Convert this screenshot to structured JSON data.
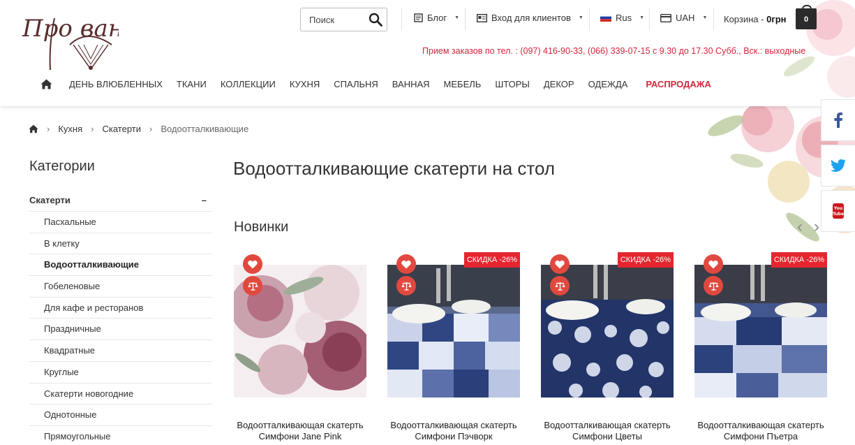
{
  "header": {
    "logo_text": "Про ванс",
    "search": {
      "placeholder": "Поиск"
    },
    "blog_label": "Блог",
    "login_label": "Вход для клиентов",
    "language_label": "Rus",
    "currency_label": "UAH",
    "cart_label": "Корзина -",
    "cart_amount": "0грн",
    "cart_count": "0",
    "hours_phones": "Прием заказов по тел. : (097) 416-90-33, (066) 339-07-15",
    "hours_time": "с 9.30 до 17.30 Субб., Вск.: выходные"
  },
  "nav": {
    "items": [
      "ДЕНЬ ВЛЮБЛЕННЫХ",
      "ТКАНИ",
      "КОЛЛЕКЦИИ",
      "КУХНЯ",
      "СПАЛЬНЯ",
      "ВАННАЯ",
      "МЕБЕЛЬ",
      "ШТОРЫ",
      "ДЕКОР",
      "ОДЕЖДА"
    ],
    "sale_label": "РАСПРОДАЖА"
  },
  "breadcrumb": {
    "items": [
      "Кухня",
      "Скатерти"
    ],
    "current": "Водоотталкивающие"
  },
  "sidebar": {
    "title": "Категории",
    "main_category": "Скатерти",
    "collapse_symbol": "–",
    "subcategories": [
      "Пасхальные",
      "В клетку",
      "Водоотталкивающие",
      "Гобеленовые",
      "Для кафе и ресторанов",
      "Праздничные",
      "Квадратные",
      "Круглые",
      "Скатерти новогодние",
      "Однотонные",
      "Прямоугольные"
    ],
    "active_index": 2
  },
  "main": {
    "page_title": "Водоотталкивающие скатерти на стол",
    "section_title": "Новинки",
    "products": [
      {
        "name": "Водоотталкивающая скатерть Симфони Jane Pink",
        "badge": ""
      },
      {
        "name": "Водоотталкивающая скатерть Симфони Пэчворк",
        "badge": "СКИДКА -26%"
      },
      {
        "name": "Водоотталкивающая скатерть Симфони Цветы",
        "badge": "СКИДКА -26%"
      },
      {
        "name": "Водоотталкивающая скатерть Симфони Пъетра",
        "badge": "СКИДКА -26%"
      }
    ]
  },
  "colors": {
    "accent_red": "#d1263c",
    "badge_red": "#e5252f",
    "button_red": "#e1493f",
    "navy": "#2c3e6b"
  }
}
